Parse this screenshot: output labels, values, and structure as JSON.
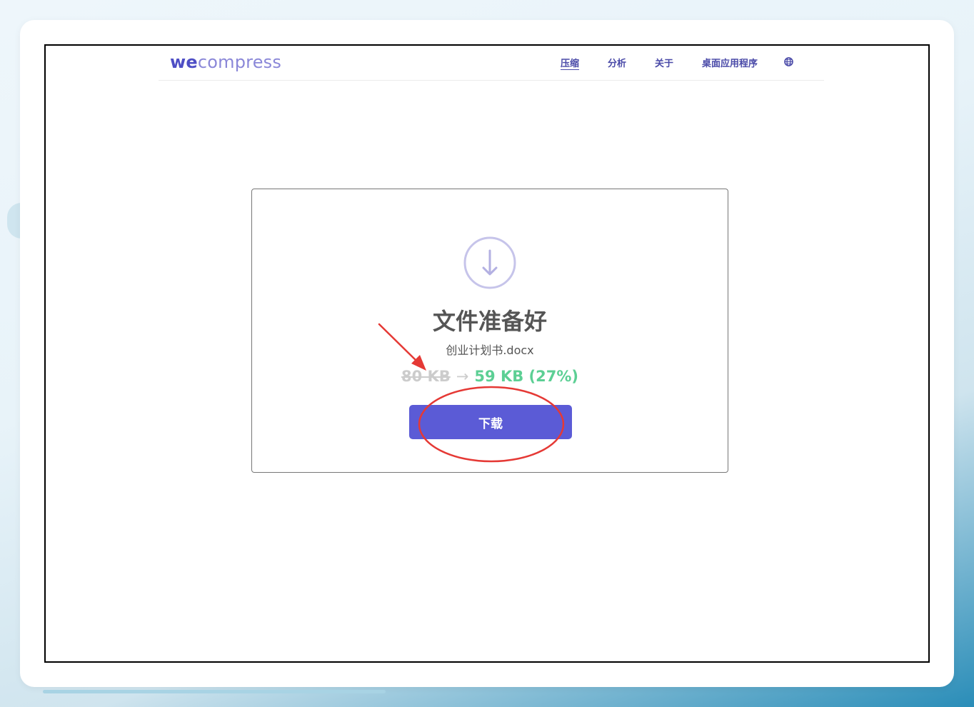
{
  "header": {
    "logo_bold": "we",
    "logo_rest": "compress",
    "nav": [
      {
        "label": "压缩",
        "active": true
      },
      {
        "label": "分析",
        "active": false
      },
      {
        "label": "关于",
        "active": false
      },
      {
        "label": "桌面应用程序",
        "active": false
      }
    ],
    "language_icon": "globe-icon"
  },
  "result": {
    "icon": "download-arrow-icon",
    "title": "文件准备好",
    "filename": "创业计划书.docx",
    "original_size": "80 KB",
    "arrow": "→",
    "compressed_size": "59 KB (27%)",
    "download_label": "下载"
  },
  "annotations": {
    "arrow_color": "#e53935",
    "ellipse_color": "#e53935"
  },
  "colors": {
    "brand": "#5b5bd6",
    "success": "#5ccf94",
    "muted": "#cccccc",
    "text": "#555555"
  }
}
